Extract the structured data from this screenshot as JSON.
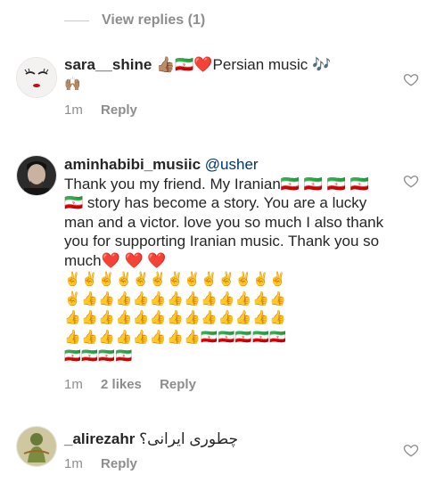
{
  "view_replies": "View replies (1)",
  "comments": [
    {
      "username": "sara__shine",
      "text": "👍🏽🇮🇷❤️Persian music 🎶",
      "text_line2": "🙌🏽",
      "time": "1m",
      "reply": "Reply"
    },
    {
      "username": "aminhabibi_musiic",
      "mention": "@usher",
      "text": "Thank you my friend. My Iranian🇮🇷 🇮🇷 🇮🇷 🇮🇷 🇮🇷 story has become a story. You are a lucky man and a victor.  love you so much I also thank you for supporting Iranian music. Thank you so much❤️ ❤️ ❤️",
      "emoji_rows": [
        "✌️✌️✌️✌️✌️✌️✌️✌️✌️✌️✌️✌️✌️",
        "✌️👍👍👍👍👍👍👍👍👍👍👍👍",
        "👍👍👍👍👍👍👍👍👍👍👍👍👍",
        "👍👍👍👍👍👍👍👍🇮🇷🇮🇷🇮🇷🇮🇷🇮🇷",
        "🇮🇷🇮🇷🇮🇷🇮🇷"
      ],
      "time": "1m",
      "likes": "2 likes",
      "reply": "Reply"
    },
    {
      "username": "_alirezahr",
      "text": "چطوری ایرانی؟",
      "time": "1m",
      "reply": "Reply"
    }
  ],
  "icons": {
    "like": "heart-outline-icon"
  },
  "colors": {
    "secondary": "#8e8e8e",
    "primary_text": "#262626",
    "mention": "#003569"
  }
}
